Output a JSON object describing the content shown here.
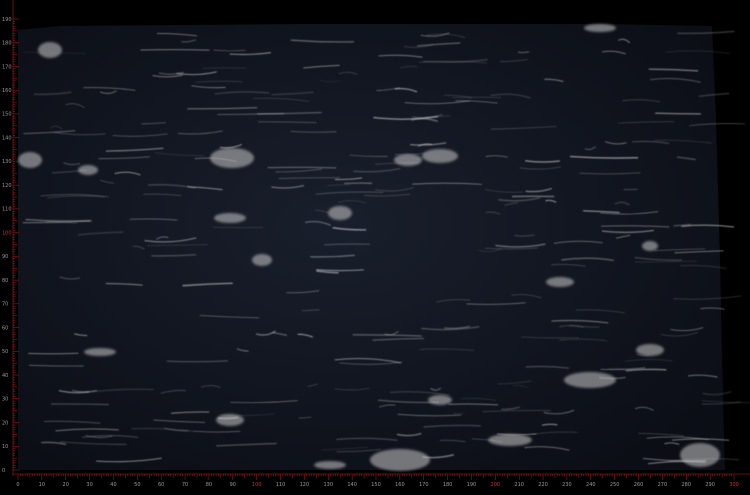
{
  "ruler": {
    "unit_step": 10,
    "vertical_labels": [
      "190",
      "180",
      "170",
      "160",
      "150",
      "140",
      "130",
      "120",
      "110",
      "100",
      "90",
      "80",
      "70",
      "60",
      "50",
      "40",
      "30",
      "20",
      "10",
      "0"
    ],
    "horizontal_labels": [
      "0",
      "10",
      "20",
      "30",
      "40",
      "50",
      "60",
      "70",
      "80",
      "90",
      "100",
      "110",
      "120",
      "130",
      "140",
      "150",
      "160",
      "170",
      "180",
      "190",
      "200",
      "210",
      "220",
      "230",
      "240",
      "250",
      "260",
      "270",
      "280",
      "290",
      "300"
    ],
    "highlight_labels": [
      "100",
      "200",
      "300"
    ],
    "label_color": "#9a9a9a",
    "highlight_color": "#d42a2a",
    "tick_color": "#b01e1e"
  },
  "slab": {
    "material": "black granite slab with white veining",
    "base_color": "#151a26",
    "vein_color": "#c9c9c9"
  }
}
